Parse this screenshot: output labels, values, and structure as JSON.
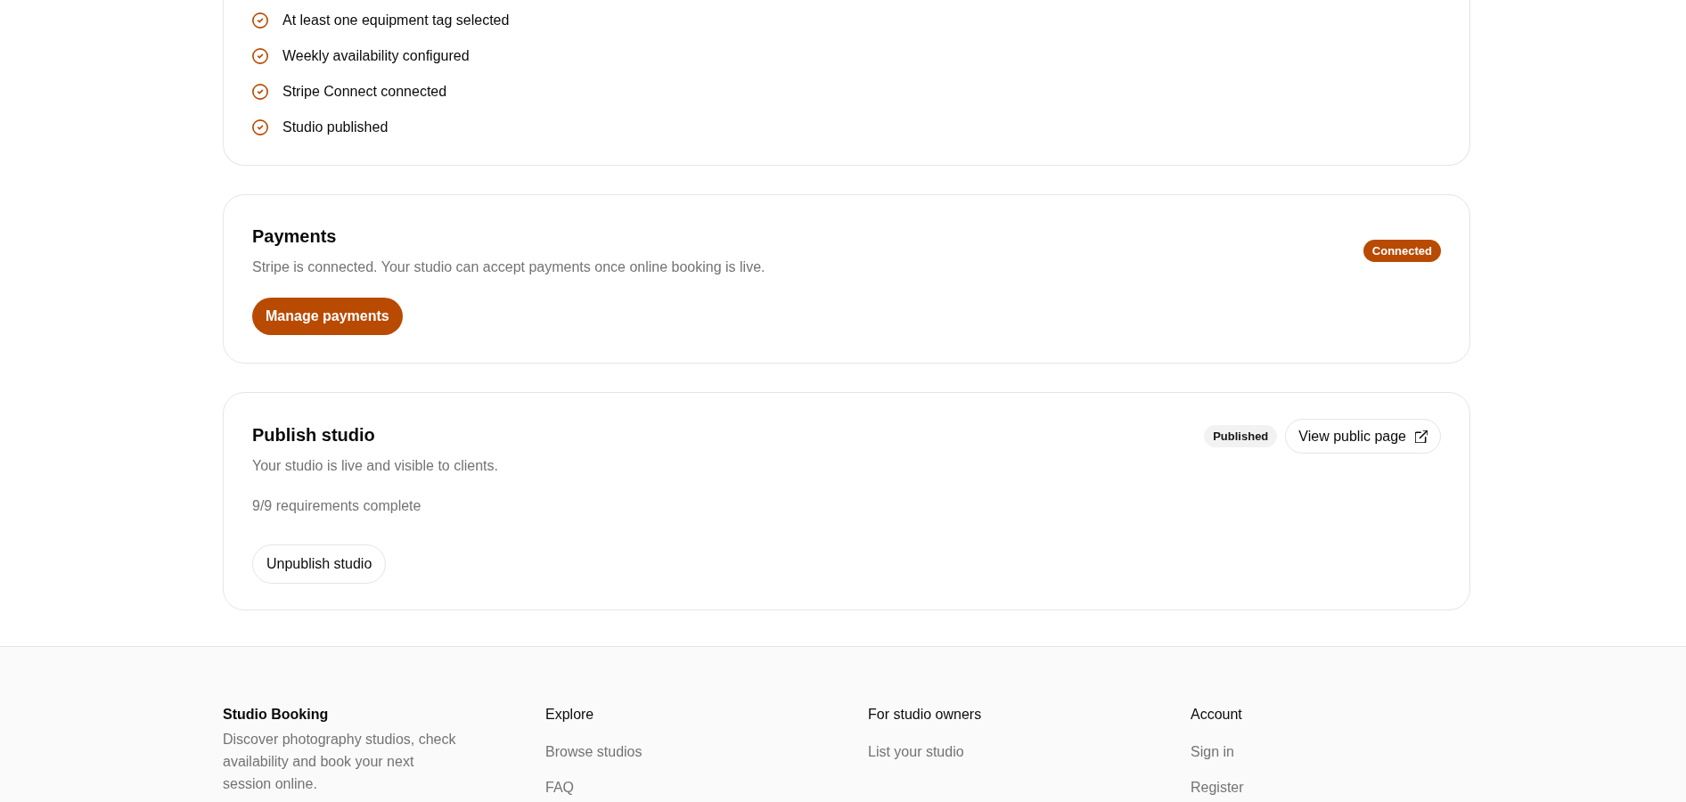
{
  "checklist": {
    "items": [
      {
        "label": "At least one equipment tag selected",
        "done": true
      },
      {
        "label": "Weekly availability configured",
        "done": true
      },
      {
        "label": "Stripe Connect connected",
        "done": true
      },
      {
        "label": "Studio published",
        "done": true
      }
    ]
  },
  "payments": {
    "title": "Payments",
    "description": "Stripe is connected. Your studio can accept payments once online booking is live.",
    "badge": "Connected",
    "button": "Manage payments"
  },
  "publish": {
    "title": "Publish studio",
    "description": "Your studio is live and visible to clients.",
    "requirements": "9/9 requirements complete",
    "badge": "Published",
    "view_button": "View public page",
    "button": "Unpublish studio"
  },
  "footer": {
    "brand": {
      "title": "Studio Booking",
      "description": "Discover photography studios, check availability and book your next session online."
    },
    "columns": [
      {
        "heading": "Explore",
        "links": [
          "Browse studios",
          "FAQ"
        ]
      },
      {
        "heading": "For studio owners",
        "links": [
          "List your studio"
        ]
      },
      {
        "heading": "Account",
        "links": [
          "Sign in",
          "Register"
        ]
      }
    ]
  }
}
